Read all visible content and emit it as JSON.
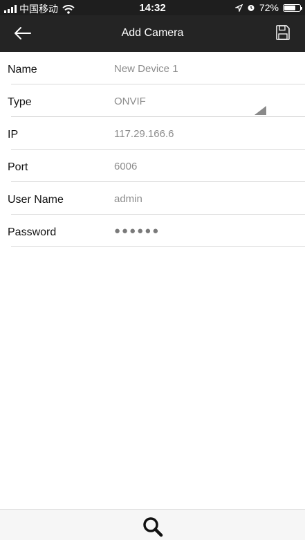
{
  "status_bar": {
    "carrier": "中国移动",
    "time": "14:32",
    "battery": "72%",
    "battery_level": 0.72
  },
  "nav": {
    "title": "Add Camera",
    "back_icon": "arrow-left-icon",
    "save_icon": "floppy-disk-icon"
  },
  "form": {
    "name_label": "Name",
    "name_value": "New Device 1",
    "type_label": "Type",
    "type_value": "ONVIF",
    "ip_label": "IP",
    "ip_value": "117.29.166.6",
    "port_label": "Port",
    "port_value": "6006",
    "user_label": "User Name",
    "user_value": "admin",
    "password_label": "Password",
    "password_value": "●●●●●●"
  },
  "bottom": {
    "search_icon": "search-icon"
  }
}
